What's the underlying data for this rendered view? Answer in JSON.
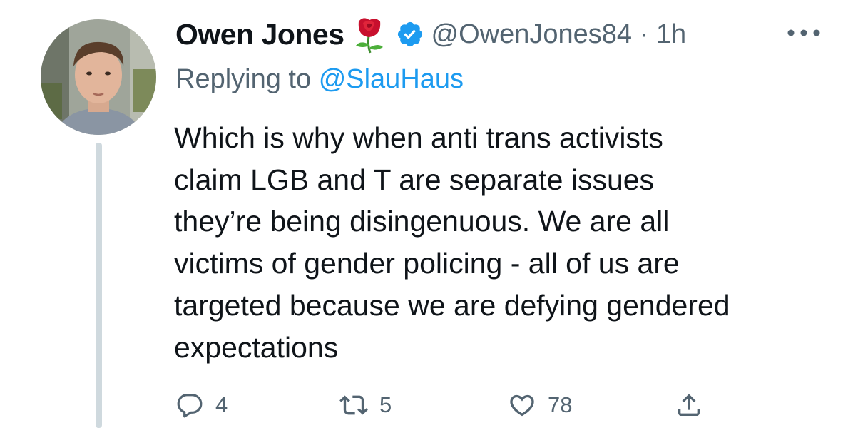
{
  "tweet": {
    "display_name": "Owen Jones",
    "handle": "@OwenJones84",
    "separator": "·",
    "time": "1h",
    "replying_prefix": "Replying to",
    "replying_to": "@SlauHaus",
    "text_lines": [
      "Which is why when anti trans activists",
      "claim LGB and T are separate issues",
      "they’re being disingenuous. We are all",
      "victims of gender policing - all of us are",
      "targeted because we are defying gendered",
      "expectations"
    ]
  },
  "actions": {
    "reply_count": "4",
    "retweet_count": "5",
    "like_count": "78"
  },
  "icons": {
    "name_emoji": "rose-icon",
    "verified": "verified-badge-icon",
    "more": "more-options-icon",
    "reply": "reply-icon",
    "retweet": "retweet-icon",
    "like": "heart-icon",
    "share": "share-icon"
  },
  "colors": {
    "text": "#0f1419",
    "secondary": "#536471",
    "link": "#1d9bf0",
    "verified": "#1d9bf0",
    "thread_line": "#cfd9de"
  }
}
